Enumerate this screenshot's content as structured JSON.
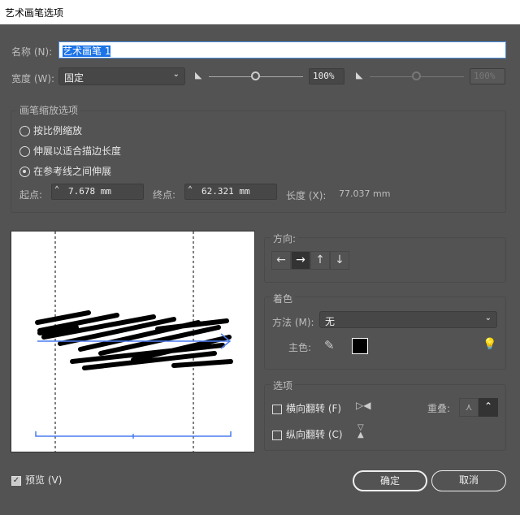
{
  "window": {
    "title": "艺术画笔选项"
  },
  "name": {
    "label": "名称 (N):",
    "value": "艺术画笔 1"
  },
  "width": {
    "label": "宽度 (W):",
    "select": "固定",
    "percent": "100%",
    "percent2": "100%",
    "slider_value": 100
  },
  "scale": {
    "title": "画笔缩放选项",
    "options": [
      {
        "label": "按比例缩放",
        "selected": false
      },
      {
        "label": "伸展以适合描边长度",
        "selected": false
      },
      {
        "label": "在参考线之间伸展",
        "selected": true
      }
    ],
    "start_label": "起点:",
    "start_value": "7.678 mm",
    "end_label": "终点:",
    "end_value": "62.321 mm",
    "length_label": "长度 (X):",
    "length_value": "77.037 mm"
  },
  "direction": {
    "title": "方向:",
    "buttons": [
      "←",
      "→",
      "↑",
      "↓"
    ],
    "selected": 1
  },
  "colorize": {
    "title": "着色",
    "method_label": "方法 (M):",
    "method_value": "无",
    "key_label": "主色:",
    "key_color": "#000000"
  },
  "options": {
    "title": "选项",
    "flip_h": "横向翻转 (F)",
    "flip_v": "纵向翻转 (C)",
    "overlap_label": "重叠:"
  },
  "footer": {
    "preview": "预览 (V)",
    "preview_checked": true,
    "ok": "确定",
    "cancel": "取消"
  },
  "colors": {
    "accent": "#4a7cf0",
    "background": "#535353"
  }
}
